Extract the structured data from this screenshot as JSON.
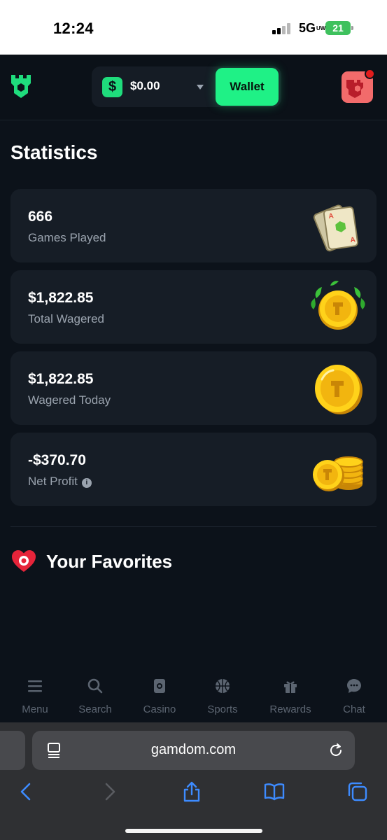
{
  "status_bar": {
    "time": "12:24",
    "network": "5G",
    "network_sub": "UW",
    "battery": "21"
  },
  "header": {
    "currency_symbol": "$",
    "balance": "$0.00",
    "wallet_label": "Wallet",
    "accent_color": "#1ff186"
  },
  "statistics": {
    "title": "Statistics",
    "cards": [
      {
        "value": "666",
        "label": "Games Played",
        "icon": "playing-cards-icon"
      },
      {
        "value": "$1,822.85",
        "label": "Total Wagered",
        "icon": "laurel-coin-icon"
      },
      {
        "value": "$1,822.85",
        "label": "Wagered Today",
        "icon": "gold-coin-icon"
      },
      {
        "value": "-$370.70",
        "label": "Net Profit",
        "icon": "coin-stack-icon"
      }
    ]
  },
  "favorites": {
    "title": "Your Favorites"
  },
  "bottom_nav": {
    "items": [
      {
        "label": "Menu",
        "icon": "hamburger-icon"
      },
      {
        "label": "Search",
        "icon": "search-icon"
      },
      {
        "label": "Casino",
        "icon": "card-icon"
      },
      {
        "label": "Sports",
        "icon": "basketball-icon"
      },
      {
        "label": "Rewards",
        "icon": "gift-icon"
      },
      {
        "label": "Chat",
        "icon": "chat-bubble-icon"
      }
    ]
  },
  "browser": {
    "url": "gamdom.com"
  }
}
